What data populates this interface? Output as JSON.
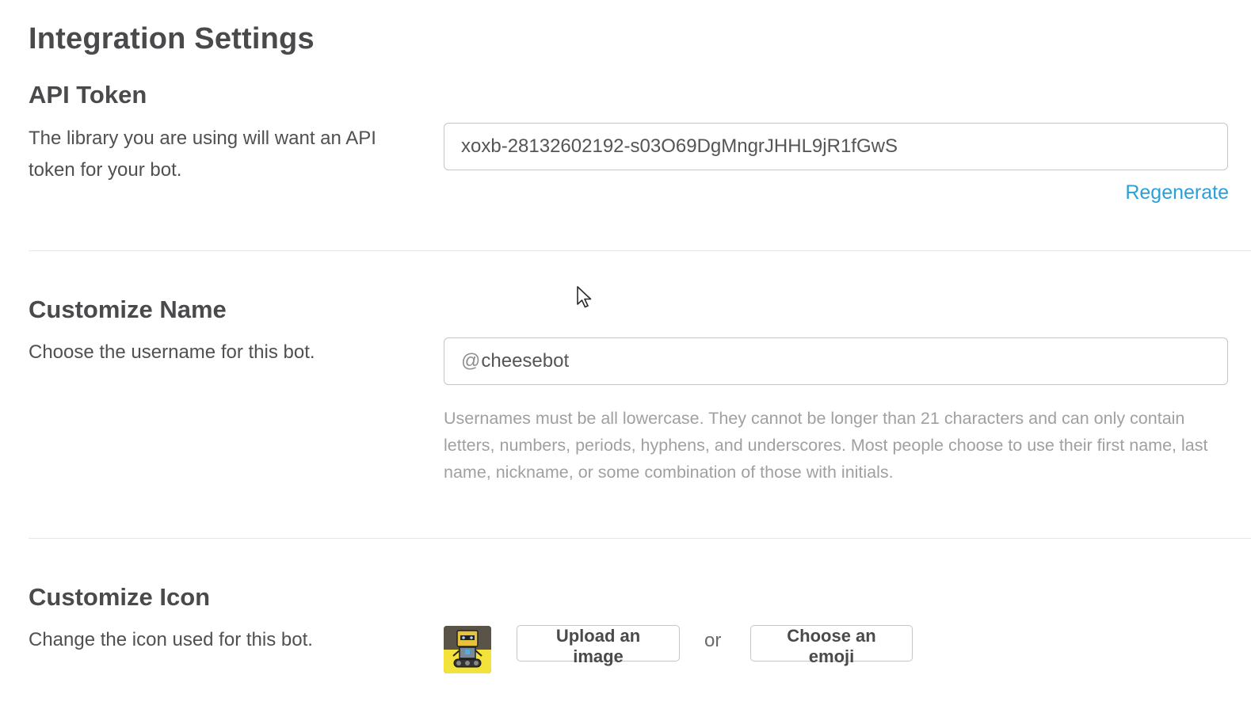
{
  "page": {
    "title": "Integration Settings"
  },
  "api_token": {
    "title": "API Token",
    "description": "The library you are using will want an API token for your bot.",
    "token_value": "xoxb-28132602192-s03O69DgMngrJHHL9jR1fGwS",
    "regenerate_label": "Regenerate"
  },
  "customize_name": {
    "title": "Customize Name",
    "description": "Choose the username for this bot.",
    "prefix": "@",
    "username_value": "cheesebot",
    "help_text": "Usernames must be all lowercase. They cannot be longer than 21 characters and can only contain letters, numbers, periods, hyphens, and underscores. Most people choose to use their first name, last name, nickname, or some combination of those with initials."
  },
  "customize_icon": {
    "title": "Customize Icon",
    "description": "Change the icon used for this bot.",
    "upload_label": "Upload an image",
    "or_label": "or",
    "emoji_label": "Choose an emoji"
  },
  "colors": {
    "link": "#2a9fd8",
    "heading": "#4a4a4d",
    "border": "#c5c5c5",
    "help_text": "#a0a0a0"
  },
  "icons": {
    "avatar": "robot-avatar-icon",
    "cursor": "mouse-cursor-icon"
  }
}
